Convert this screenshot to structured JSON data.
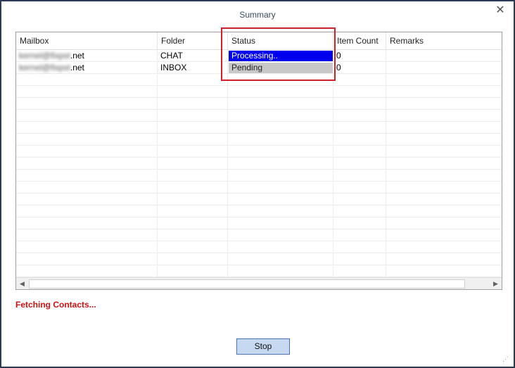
{
  "window": {
    "title": "Summary",
    "close_glyph": "✕"
  },
  "table": {
    "columns": [
      "Mailbox",
      "Folder",
      "Status",
      "Item Count",
      "Remarks"
    ],
    "rows": [
      {
        "mailbox_hidden": "kernel@fixpst",
        "mailbox_suffix": ".net",
        "folder": "CHAT",
        "status": "Processing..",
        "item_count": "0",
        "remarks": ""
      },
      {
        "mailbox_hidden": "kernel@fixpst",
        "mailbox_suffix": ".net",
        "folder": "INBOX",
        "status": "Pending",
        "item_count": "0",
        "remarks": ""
      }
    ],
    "status_colors": {
      "processing": "#0000ee",
      "pending": "#c8c8c8"
    }
  },
  "progress_message": "Fetching Contacts...",
  "buttons": {
    "stop_label": "Stop"
  },
  "icons": {
    "scroll_left": "◀",
    "scroll_right": "▶",
    "resize_grip": "⋰"
  }
}
